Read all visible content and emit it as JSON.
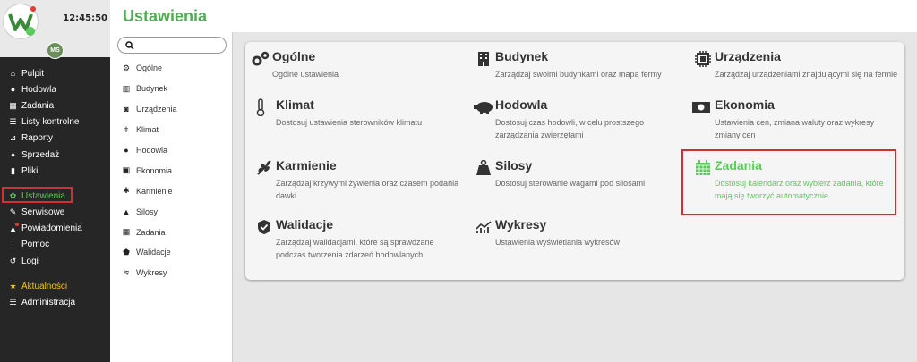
{
  "clock": "12:45:50",
  "user_initials": "MS",
  "page_title": "Ustawienia",
  "colors": {
    "accent": "#4caf50",
    "sidebar_bg": "#262626",
    "highlight_border": "#d32f2f",
    "news": "#f5c518"
  },
  "nav": [
    {
      "label": "Pulpit",
      "icon": "home-icon"
    },
    {
      "label": "Hodowla",
      "icon": "pig-icon"
    },
    {
      "label": "Zadania",
      "icon": "calendar-icon"
    },
    {
      "label": "Listy kontrolne",
      "icon": "checklist-icon"
    },
    {
      "label": "Raporty",
      "icon": "chart-icon"
    },
    {
      "label": "Sprzedaż",
      "icon": "bag-icon"
    },
    {
      "label": "Pliki",
      "icon": "file-icon"
    },
    {
      "label": "Ustawienia",
      "icon": "gear-icon"
    },
    {
      "label": "Serwisowe",
      "icon": "wrench-icon"
    },
    {
      "label": "Powiadomienia",
      "icon": "bell-icon"
    },
    {
      "label": "Pomoc",
      "icon": "info-icon"
    },
    {
      "label": "Logi",
      "icon": "history-icon"
    },
    {
      "label": "Aktualności",
      "icon": "star-icon"
    },
    {
      "label": "Administracja",
      "icon": "list-icon"
    }
  ],
  "search": {
    "placeholder": ""
  },
  "submenu": [
    {
      "label": "Ogólne",
      "icon": "gears-icon"
    },
    {
      "label": "Budynek",
      "icon": "building-icon"
    },
    {
      "label": "Urządzenia",
      "icon": "chip-icon"
    },
    {
      "label": "Klimat",
      "icon": "thermometer-icon"
    },
    {
      "label": "Hodowla",
      "icon": "pig-icon"
    },
    {
      "label": "Ekonomia",
      "icon": "money-icon"
    },
    {
      "label": "Karmienie",
      "icon": "wheat-icon"
    },
    {
      "label": "Silosy",
      "icon": "weight-icon"
    },
    {
      "label": "Zadania",
      "icon": "calendar-icon"
    },
    {
      "label": "Walidacje",
      "icon": "shield-icon"
    },
    {
      "label": "Wykresy",
      "icon": "graph-icon"
    }
  ],
  "tiles": [
    {
      "title": "Ogólne",
      "desc": "Ogólne ustawienia",
      "icon": "gears-icon"
    },
    {
      "title": "Budynek",
      "desc": "Zarządzaj swoimi budynkami oraz mapą fermy",
      "icon": "building-icon"
    },
    {
      "title": "Urządzenia",
      "desc": "Zarządzaj urządzeniami znajdującymi się na fermie",
      "icon": "chip-icon"
    },
    {
      "title": "Klimat",
      "desc": "Dostosuj ustawienia sterowników klimatu",
      "icon": "thermometer-icon"
    },
    {
      "title": "Hodowla",
      "desc": "Dostosuj czas hodowli, w celu prostszego zarządzania zwierzętami",
      "icon": "pig-icon"
    },
    {
      "title": "Ekonomia",
      "desc": "Ustawienia cen, zmiana waluty oraz wykresy zmiany cen",
      "icon": "money-icon"
    },
    {
      "title": "Karmienie",
      "desc": "Zarządzaj krzywymi żywienia oraz czasem podania dawki",
      "icon": "wheat-icon"
    },
    {
      "title": "Silosy",
      "desc": "Dostosuj sterowanie wagami pod silosami",
      "icon": "weight-icon"
    },
    {
      "title": "Zadania",
      "desc": "Dostosuj kalendarz oraz wybierz zadania, które mają się tworzyć automatycznie",
      "icon": "calendar-icon"
    },
    {
      "title": "Walidacje",
      "desc": "Zarządzaj walidacjami, które są sprawdzane podczas tworzenia zdarzeń hodowlanych",
      "icon": "shield-icon"
    },
    {
      "title": "Wykresy",
      "desc": "Ustawienia wyświetlania wykresów",
      "icon": "graph-icon"
    }
  ]
}
